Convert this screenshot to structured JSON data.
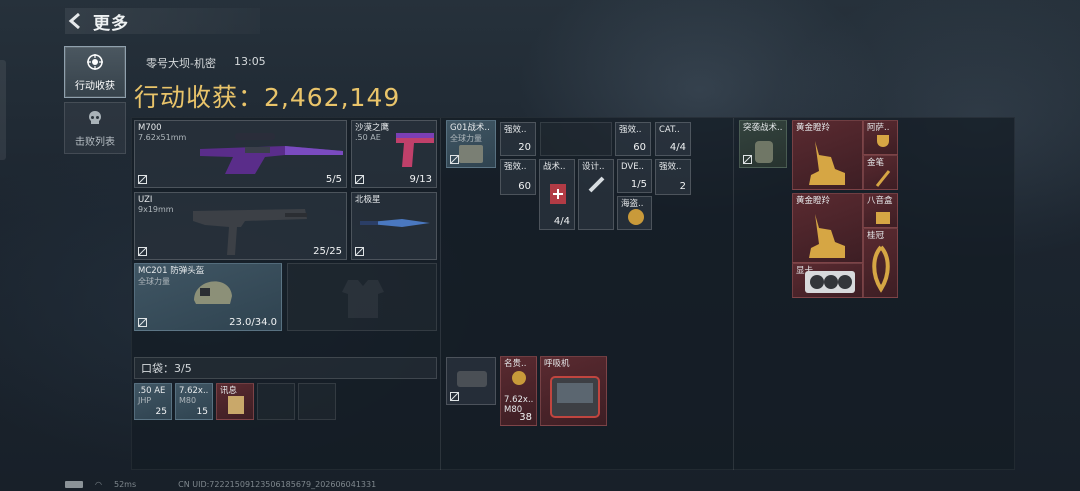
{
  "header": {
    "title": "更多"
  },
  "tabs": [
    {
      "label": "行动收获",
      "active": true
    },
    {
      "label": "击败列表",
      "active": false
    }
  ],
  "map": {
    "name": "零号大坝-机密",
    "time": "13:05"
  },
  "haul": {
    "label": "行动收获：",
    "value": "2,462,149"
  },
  "weapons": [
    {
      "name": "M700",
      "sub": "7.62x51mm",
      "count": "5/5"
    },
    {
      "name": "沙漠之鹰",
      "sub": ".50 AE",
      "count": "9/13"
    },
    {
      "name": "UZI",
      "sub": "9x19mm",
      "count": "25/25"
    },
    {
      "name": "北极星",
      "sub": "",
      "count": ""
    },
    {
      "name": "MC201 防弹头盔",
      "sub": "全球力量",
      "count": "23.0/34.0"
    }
  ],
  "pocket": {
    "label": "口袋：3/5",
    "items": [
      {
        "name": ".50 AE",
        "sub": "JHP",
        "count": "25"
      },
      {
        "name": "7.62x..",
        "sub": "M80",
        "count": "15"
      },
      {
        "name": "讯息",
        "sub": "",
        "count": ""
      }
    ]
  },
  "rig": {
    "name": "G01战术..",
    "sub": "全球力量"
  },
  "rig_items": [
    {
      "name": "强效..",
      "count": "20"
    },
    {
      "name": "强效..",
      "count": "60"
    },
    {
      "name": "强效..",
      "count": "60"
    },
    {
      "name": "CAT..",
      "count": "4/4"
    },
    {
      "name": "战术..",
      "count": "4/4"
    },
    {
      "name": "设计..",
      "count": ""
    },
    {
      "name": "DVE..",
      "count": "1/5"
    },
    {
      "name": "海盗..",
      "count": ""
    },
    {
      "name": "强效..",
      "count": "2"
    }
  ],
  "case": {
    "items": [
      {
        "name": "名贵..",
        "sub": "7.62x..",
        "sub2": "M80",
        "count": "38"
      },
      {
        "name": "呼吸机",
        "count": ""
      }
    ]
  },
  "backpack": {
    "name": "突袭战术..",
    "items": [
      {
        "name": "黄金瞪羚"
      },
      {
        "name": "黄金瞪羚"
      },
      {
        "name": "阿萨.."
      },
      {
        "name": "金笔"
      },
      {
        "name": "八音盒"
      },
      {
        "name": "桂冠"
      },
      {
        "name": "显卡"
      }
    ]
  },
  "status": {
    "ping": "52ms",
    "uid": "CN UID:7222150912350618567​9_202606041331"
  }
}
